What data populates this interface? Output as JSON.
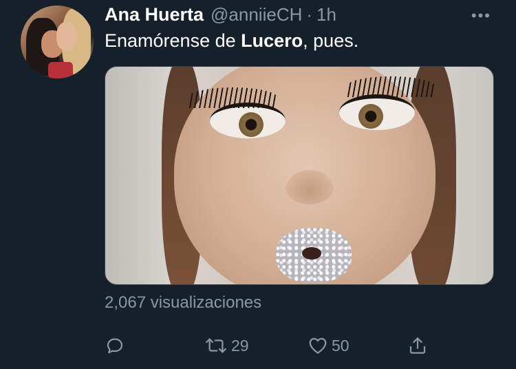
{
  "tweet": {
    "author_name": "Ana Huerta",
    "author_handle": "@anniieCH",
    "separator": "·",
    "time": "1h",
    "more_label": "•••",
    "text_before": "Enamórense de ",
    "text_bold": "Lucero",
    "text_after": ", pues.",
    "views": "2,067 visualizaciones"
  },
  "actions": {
    "reply": {
      "icon": "reply-icon",
      "count": ""
    },
    "retweet": {
      "icon": "retweet-icon",
      "count": "29"
    },
    "like": {
      "icon": "heart-icon",
      "count": "50"
    },
    "share": {
      "icon": "share-icon",
      "count": ""
    }
  },
  "colors": {
    "background": "#15202b",
    "text": "#ffffff",
    "secondary": "#8899a6"
  }
}
